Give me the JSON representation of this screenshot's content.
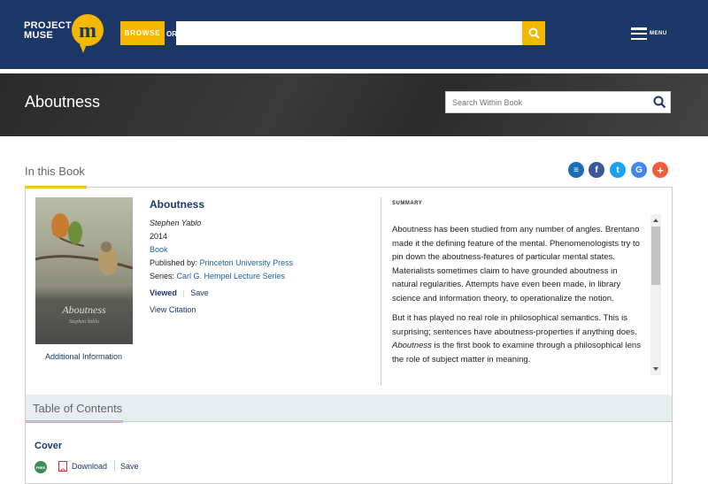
{
  "header": {
    "logo_line1": "PROJECT",
    "logo_line2": "MUSE",
    "browse_label": "BROWSE",
    "or_label": "OR",
    "search_value": "",
    "menu_label": "MENU"
  },
  "banner": {
    "book_title": "Aboutness",
    "within_placeholder": "Search Within Book"
  },
  "section": {
    "heading": "In this Book",
    "share": [
      {
        "name": "list-icon",
        "color": "#1a6fb3",
        "glyph": "≡"
      },
      {
        "name": "facebook-icon",
        "color": "#3b5998",
        "glyph": "f"
      },
      {
        "name": "twitter-icon",
        "color": "#1da1f2",
        "glyph": "t"
      },
      {
        "name": "google-icon",
        "color": "#4285f4",
        "glyph": "G"
      },
      {
        "name": "plus-icon",
        "color": "#f25c3a",
        "glyph": "+"
      }
    ]
  },
  "book": {
    "title": "Aboutness",
    "author": "Stephen Yablo",
    "year": "2014",
    "type": "Book",
    "published_by_label": "Published by:",
    "publisher": "Princeton University Press",
    "series_label": "Series:",
    "series": "Carl G. Hempel Lecture Series",
    "viewed": "Viewed",
    "save": "Save",
    "view_citation": "View Citation",
    "additional_info": "Additional Information",
    "cover_title": "Aboutness",
    "cover_author": "Stephen Yablo"
  },
  "summary": {
    "label": "SUMMARY",
    "p1": "Aboutness has been studied from any number of angles. Brentano made it the defining feature of the mental. Phenomenologists try to pin down the aboutness-features of particular mental states. Materialists sometimes claim to have grounded aboutness in natural regularities. Attempts have even been made, in library science and information theory, to operationalize the notion.",
    "p2a": "But it has played no real role in philosophical semantics. This is surprising; sentences have aboutness-properties if anything does. ",
    "p2_italic": "Aboutness",
    "p2b": " is the first book to examine through a philosophical lens the role of subject matter in meaning."
  },
  "toc": {
    "label": "Table of Contents",
    "item_title": "Cover",
    "free_label": "FREE",
    "download": "Download",
    "save": "Save"
  }
}
